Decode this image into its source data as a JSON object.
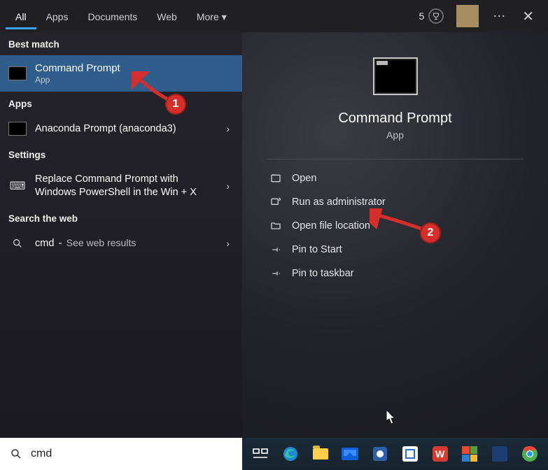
{
  "tabs": [
    "All",
    "Apps",
    "Documents",
    "Web",
    "More"
  ],
  "active_tab": 0,
  "rewards_points": "5",
  "left": {
    "sections": {
      "best_match": "Best match",
      "apps": "Apps",
      "settings": "Settings",
      "search_web": "Search the web"
    },
    "best_match_item": {
      "title": "Command Prompt",
      "sub": "App"
    },
    "apps_items": [
      {
        "title": "Anaconda Prompt (anaconda3)"
      }
    ],
    "settings_items": [
      {
        "title": "Replace Command Prompt with Windows PowerShell in the Win + X"
      }
    ],
    "web_items": [
      {
        "title": "cmd",
        "sub": "See web results"
      }
    ]
  },
  "preview": {
    "title": "Command Prompt",
    "sub": "App",
    "actions": [
      {
        "icon": "open-icon",
        "label": "Open"
      },
      {
        "icon": "shield-icon",
        "label": "Run as administrator"
      },
      {
        "icon": "folder-icon",
        "label": "Open file location"
      },
      {
        "icon": "pin-icon",
        "label": "Pin to Start"
      },
      {
        "icon": "pin-icon",
        "label": "Pin to taskbar"
      }
    ]
  },
  "search": {
    "value": "cmd"
  },
  "taskbar": [
    "task-view",
    "edge",
    "explorer",
    "mail",
    "app",
    "store",
    "wps",
    "office",
    "blue",
    "chrome"
  ],
  "annotations": {
    "badge1": "1",
    "badge2": "2"
  }
}
